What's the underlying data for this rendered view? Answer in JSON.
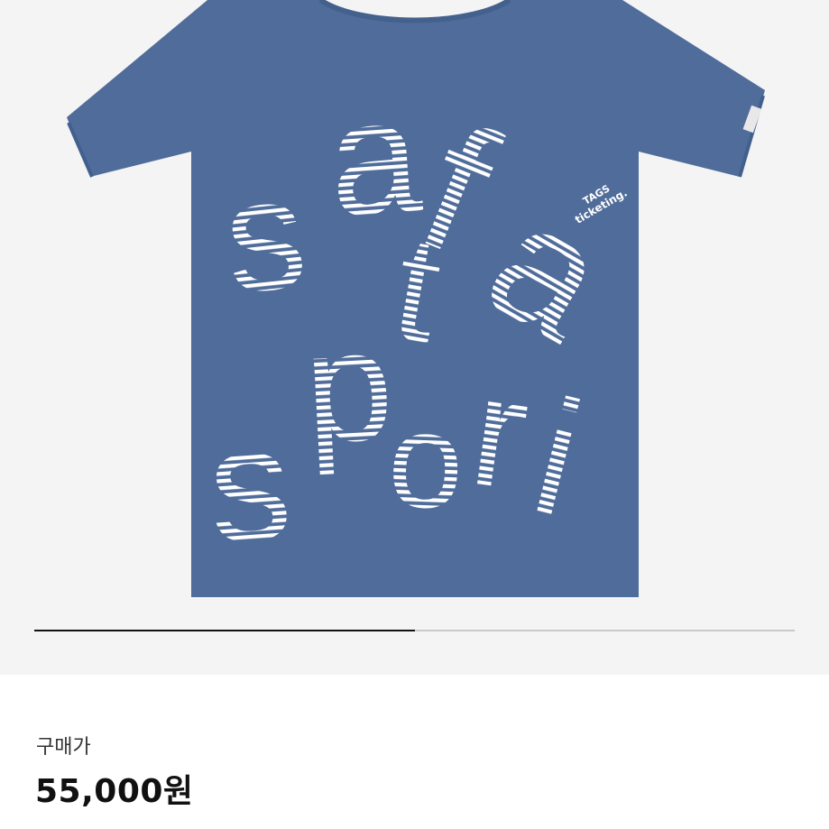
{
  "gallery": {
    "image_progress": 0.5,
    "shirt": {
      "print_letters": [
        "s",
        "a",
        "f",
        "a",
        "s",
        "p",
        "t",
        "a",
        "s",
        "p",
        "o",
        "r",
        "i"
      ],
      "tag_line1": "TAGS",
      "tag_line2": "ticketing.",
      "colors": {
        "shirt": "#4f6c9a",
        "print": "#ffffff",
        "background": "#f4f4f4"
      }
    }
  },
  "price": {
    "label": "구매가",
    "value": "55,000원"
  }
}
